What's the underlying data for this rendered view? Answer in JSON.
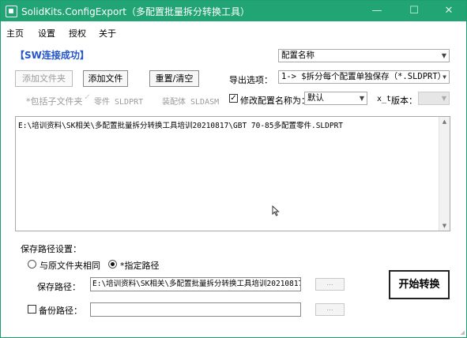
{
  "window": {
    "title": "SolidKits.ConfigExport（多配置批量拆分转换工具）",
    "controls": {
      "minimize": "—",
      "maximize": "☐",
      "close": "✕"
    },
    "accent_color": "#22a575"
  },
  "menu": {
    "items": [
      "主页",
      "设置",
      "授权",
      "关于"
    ]
  },
  "status": {
    "text": "【SW连接成功】",
    "color": "#2255cc"
  },
  "config_name": {
    "value": "配置名称"
  },
  "buttons": {
    "add_folder": "添加文件夹",
    "add_file": "添加文件",
    "reset": "重置/清空",
    "start": "开始转换",
    "browse": "..."
  },
  "export": {
    "label": "导出选项：",
    "value": "1-> $拆分每个配置单独保存（*.SLDPRT）"
  },
  "filters": {
    "include_subfolder": "*包括子文件夹",
    "part": "零件 SLDPRT",
    "assembly": "装配体 SLDASM"
  },
  "rename": {
    "label": "修改配置名称为：",
    "checked": true,
    "value": "默认",
    "suffix": "x_t",
    "version_label": "版本：",
    "version_value": ""
  },
  "files": [
    "E:\\培训资料\\SK相关\\多配置批量拆分转换工具培训20210817\\GBT 70-85多配置零件.SLDPRT"
  ],
  "save": {
    "section_label": "保存路径设置：",
    "same_as_source": "与原文件夹相同",
    "specified_path": "*指定路径",
    "path_label": "保存路径：",
    "path_value": "E:\\培训资料\\SK相关\\多配置批量拆分转换工具培训20210817\\",
    "backup_label": "备份路径：",
    "backup_value": ""
  }
}
